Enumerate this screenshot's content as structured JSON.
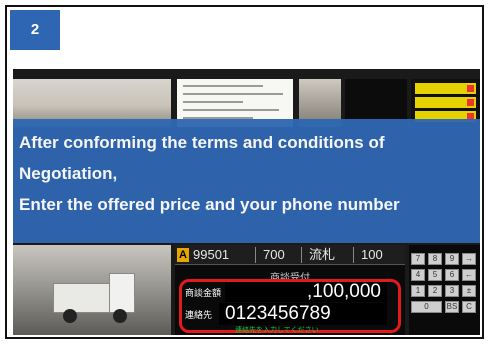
{
  "step": {
    "number": "2"
  },
  "banner": {
    "line1": "After conforming the terms and conditions of",
    "line2": "Negotiation,",
    "line3": "Enter the offered price and your phone number"
  },
  "lot": {
    "tag": "A",
    "number": "99501",
    "col2": "700",
    "col3": "流札",
    "col4": "100"
  },
  "negotiation": {
    "title": "商談受付"
  },
  "form": {
    "price_label": "商談金額",
    "price_value": ",100,000",
    "phone_label": "連絡先",
    "phone_value": "0123456789",
    "phone_hint": "連絡先を入力してください"
  },
  "keypad": {
    "keys": [
      "7",
      "8",
      "9",
      "→",
      "4",
      "5",
      "6",
      "←",
      "1",
      "2",
      "3",
      "±",
      "0",
      "",
      "BS",
      "C"
    ]
  },
  "colors": {
    "banner": "#2f67b1",
    "badge": "#2f66b3",
    "highlight": "#e11b1b",
    "hint": "#21c23c"
  }
}
